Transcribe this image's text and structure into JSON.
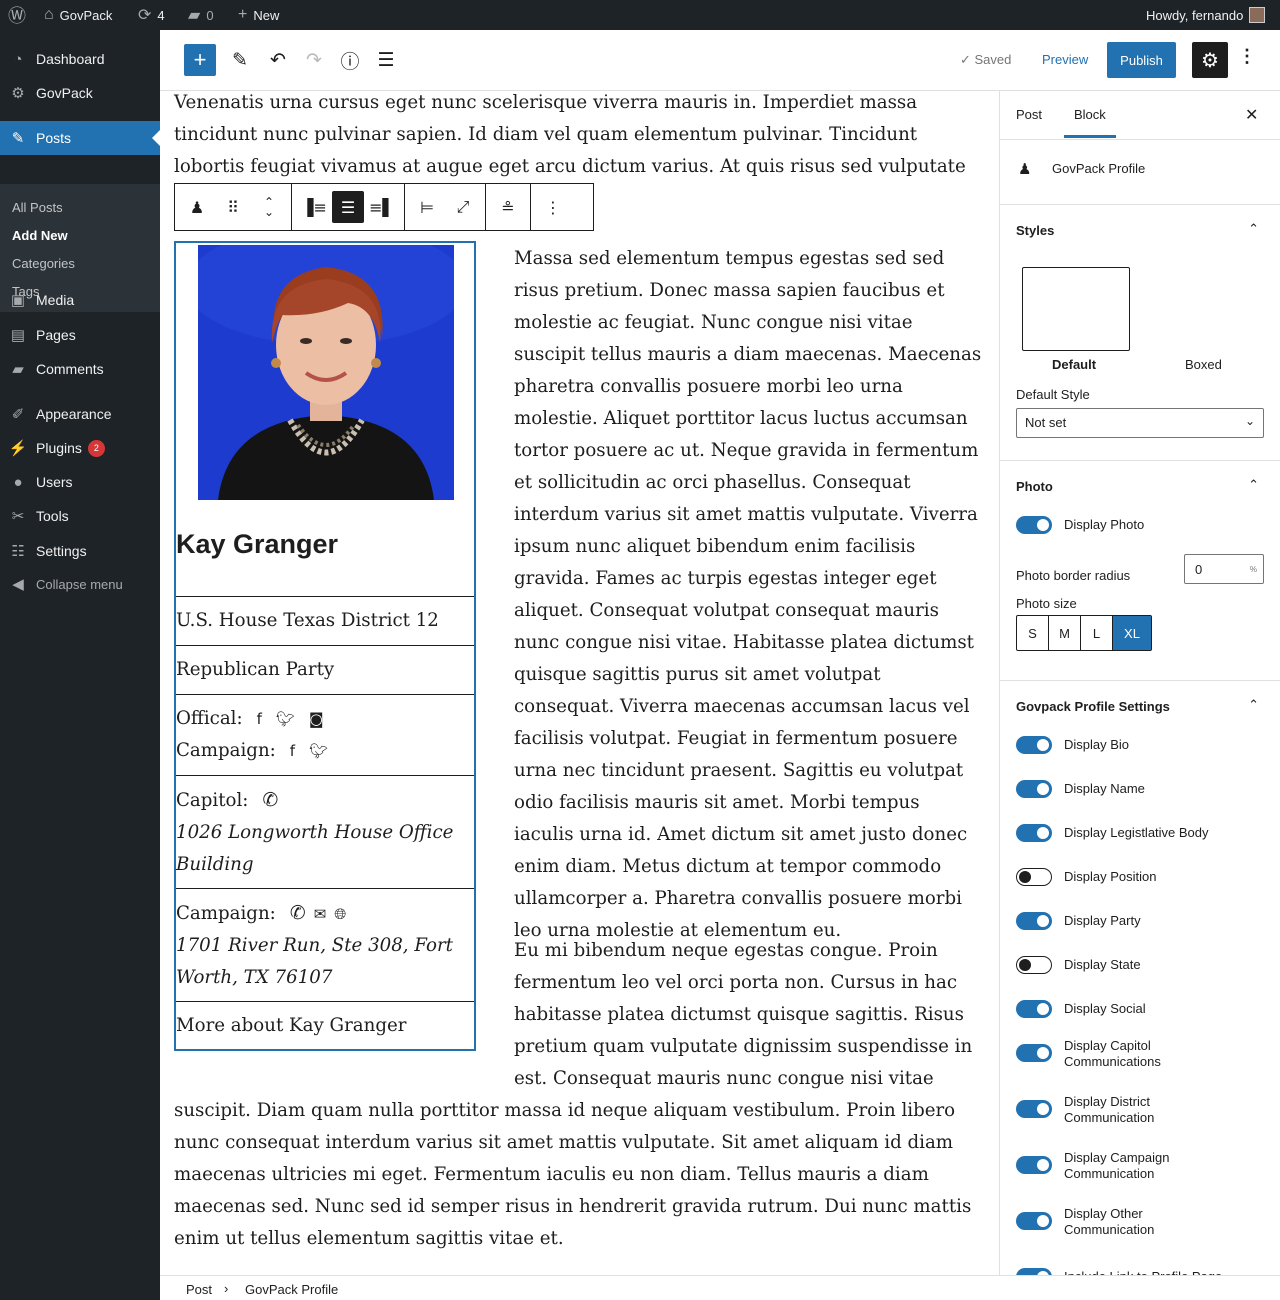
{
  "adminbar": {
    "site_name": "GovPack",
    "updates": "4",
    "comments": "0",
    "new_label": "New",
    "howdy": "Howdy, fernando"
  },
  "menu": {
    "dashboard": "Dashboard",
    "govpack": "GovPack",
    "posts": "Posts",
    "posts_sub": [
      "All Posts",
      "Add New",
      "Categories",
      "Tags"
    ],
    "media": "Media",
    "pages": "Pages",
    "comments": "Comments",
    "appearance": "Appearance",
    "plugins": "Plugins",
    "plugins_badge": "2",
    "users": "Users",
    "tools": "Tools",
    "settings": "Settings",
    "collapse": "Collapse menu"
  },
  "toolbar": {
    "saved": "Saved",
    "preview": "Preview",
    "publish": "Publish"
  },
  "content": {
    "p1": "Venenatis urna cursus eget nunc scelerisque viverra mauris in. Imperdiet massa tincidunt nunc pulvinar sapien. Id diam vel quam elementum pulvinar. Tincidunt lobortis feugiat vivamus at augue eget arcu dictum varius. At quis risus sed vulputate odio. Netus et",
    "p2": "Massa sed elementum tempus egestas sed sed risus pretium. Donec massa sapien faucibus et molestie ac feugiat. Nunc congue nisi vitae suscipit tellus mauris a diam maecenas. Maecenas pharetra convallis posuere morbi leo urna molestie. Aliquet porttitor lacus luctus accumsan tortor posuere ac ut. Neque gravida in fermentum et sollicitudin ac orci phasellus. Consequat interdum varius sit amet mattis vulputate. Viverra ipsum nunc aliquet bibendum enim facilisis gravida. Fames ac turpis egestas integer eget aliquet. Consequat volutpat consequat mauris nunc congue nisi vitae. Habitasse platea dictumst quisque sagittis purus sit amet volutpat consequat. Viverra maecenas accumsan lacus vel facilisis volutpat. Feugiat in fermentum posuere urna nec tincidunt praesent. Sagittis eu volutpat odio facilisis mauris sit amet. Morbi tempus iaculis urna id. Amet dictum sit amet justo donec enim diam. Metus dictum at tempor commodo ullamcorper a. Pharetra convallis posuere morbi leo urna molestie at elementum eu.",
    "p3": "Eu mi bibendum neque egestas congue. Proin fermentum leo vel orci porta non. Cursus in hac habitasse platea dictumst quisque sagittis. Risus pretium quam vulputate dignissim suspendisse in est. Consequat mauris nunc congue nisi vitae",
    "p4": "suscipit. Diam quam nulla porttitor massa id neque aliquam vestibulum. Proin libero nunc consequat interdum varius sit amet mattis vulputate. Sit amet aliquam id diam maecenas ultricies mi eget. Fermentum iaculis eu non diam. Tellus mauris a diam maecenas sed. Nunc sed id semper risus in hendrerit gravida rutrum. Dui nunc mattis enim ut tellus elementum sagittis vitae et."
  },
  "profile": {
    "name": "Kay Granger",
    "position": "U.S. House Texas District 12",
    "party": "Republican Party",
    "official_label": "Offical:",
    "campaign_social_label": "Campaign:",
    "capitol_label": "Capitol:",
    "capitol_address": "1026 Longworth House Office Building",
    "campaign_label": "Campaign:",
    "campaign_address": "1701 River Run, Ste 308, Fort Worth, TX 76107",
    "more_link": "More about Kay Granger"
  },
  "sidebar": {
    "tab_post": "Post",
    "tab_block": "Block",
    "block_name": "GovPack Profile",
    "styles": {
      "title": "Styles",
      "default": "Default",
      "boxed": "Boxed",
      "default_style_label": "Default Style",
      "default_style_value": "Not set"
    },
    "photo": {
      "title": "Photo",
      "display_photo": "Display Photo",
      "border_radius_label": "Photo border radius",
      "border_radius_value": "0",
      "border_radius_unit": "%",
      "size_label": "Photo size",
      "sizes": [
        "S",
        "M",
        "L",
        "XL"
      ],
      "selected_size": "XL"
    },
    "settings": {
      "title": "Govpack Profile Settings",
      "toggles": [
        {
          "label": "Display Bio",
          "on": true
        },
        {
          "label": "Display Name",
          "on": true
        },
        {
          "label": "Display Legistlative Body",
          "on": true
        },
        {
          "label": "Display Position",
          "on": false
        },
        {
          "label": "Display Party",
          "on": true
        },
        {
          "label": "Display State",
          "on": false
        },
        {
          "label": "Display Social",
          "on": true
        },
        {
          "label": "Display Capitol Communications",
          "on": true
        },
        {
          "label": "Display District Communication",
          "on": true
        },
        {
          "label": "Display Campaign Communication",
          "on": true
        },
        {
          "label": "Display Other Communication",
          "on": true
        },
        {
          "label": "Include Link to Profile Page",
          "on": true
        }
      ]
    }
  },
  "breadcrumb": {
    "root": "Post",
    "current": "GovPack Profile"
  },
  "colors": {
    "accent": "#2271b1",
    "admin_dark": "#1d2327"
  }
}
